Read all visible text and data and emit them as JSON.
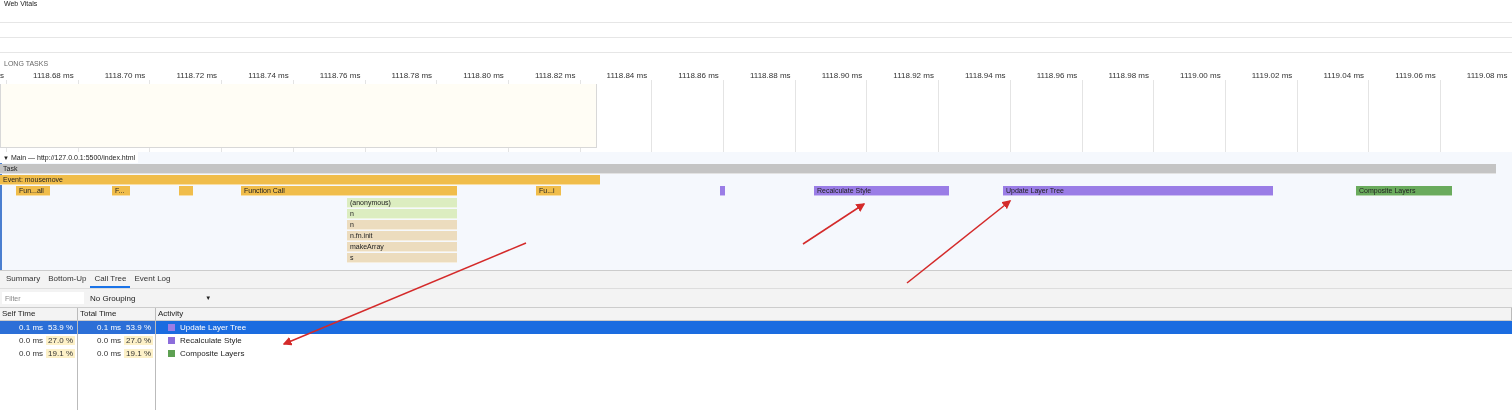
{
  "sections": {
    "web_vitals": "Web Vitals",
    "long_tasks": "LONG TASKS"
  },
  "ruler": {
    "ticks": [
      "s",
      "1118.68 ms",
      "1118.70 ms",
      "1118.72 ms",
      "1118.74 ms",
      "1118.76 ms",
      "1118.78 ms",
      "1118.80 ms",
      "1118.82 ms",
      "1118.84 ms",
      "1118.86 ms",
      "1118.88 ms",
      "1118.90 ms",
      "1118.92 ms",
      "1118.94 ms",
      "1118.96 ms",
      "1118.98 ms",
      "1119.00 ms",
      "1119.02 ms",
      "1119.04 ms",
      "1119.06 ms",
      "1119.08 ms"
    ]
  },
  "main_track": {
    "toggle": "▼",
    "title": "Main — http://127.0.0.1:5500/index.html",
    "expanded": true
  },
  "flame_chart": {
    "rows": [
      [
        {
          "label": "Task",
          "kind": "task"
        }
      ],
      [
        {
          "label": "Event: mousemove",
          "kind": "event"
        }
      ],
      [
        {
          "label": "Fun...all",
          "kind": "function"
        },
        {
          "label": "F...",
          "kind": "function"
        },
        {
          "kind": "function"
        },
        {
          "label": "Function Call",
          "kind": "function"
        },
        {
          "label": "Fu...i",
          "kind": "function"
        },
        {
          "kind": "rendering"
        },
        {
          "label": "Recalculate Style",
          "kind": "rendering"
        },
        {
          "label": "Update Layer Tree",
          "kind": "rendering"
        },
        {
          "label": "Composite Layers",
          "kind": "painting"
        }
      ],
      [
        {
          "label": "(anonymous)",
          "kind": "script"
        }
      ],
      [
        {
          "label": "n",
          "kind": "script"
        }
      ],
      [
        {
          "label": "n",
          "kind": "library"
        }
      ],
      [
        {
          "label": "n.fn.init",
          "kind": "library"
        }
      ],
      [
        {
          "label": "makeArray",
          "kind": "library"
        }
      ],
      [
        {
          "label": "s",
          "kind": "library"
        }
      ]
    ]
  },
  "tabs": [
    {
      "label": "Summary",
      "selected": false
    },
    {
      "label": "Bottom-Up",
      "selected": false
    },
    {
      "label": "Call Tree",
      "selected": true
    },
    {
      "label": "Event Log",
      "selected": false
    }
  ],
  "toolbar": {
    "filter": {
      "placeholder": "Filter"
    },
    "grouping": {
      "value": "No Grouping",
      "caret": "▼"
    }
  },
  "table": {
    "columns": [
      "Self Time",
      "Total Time",
      "Activity"
    ],
    "rows": [
      {
        "self_time": "0.1 ms",
        "self_percent": "53.9 %",
        "total_time": "0.1 ms",
        "total_percent": "53.9 %",
        "activity": "Update Layer Tree",
        "color": "#9a7de6",
        "selected": true
      },
      {
        "self_time": "0.0 ms",
        "self_percent": "27.0 %",
        "total_time": "0.0 ms",
        "total_percent": "27.0 %",
        "activity": "Recalculate Style",
        "color": "#8c6ddb",
        "selected": false
      },
      {
        "self_time": "0.0 ms",
        "self_percent": "19.1 %",
        "total_time": "0.0 ms",
        "total_percent": "19.1 %",
        "activity": "Composite Layers",
        "color": "#5da052",
        "selected": false
      }
    ]
  }
}
